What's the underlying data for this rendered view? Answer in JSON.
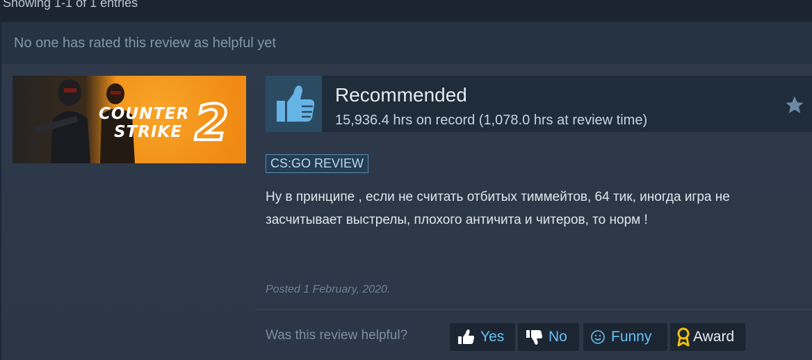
{
  "listing": {
    "entries_text": "Showing 1-1 of 1 entries"
  },
  "review": {
    "helpful_count_text": "No one has rated this review as helpful yet",
    "game": {
      "logo_line1": "COUNTER",
      "logo_line2": "STRIKE",
      "logo_number": "2"
    },
    "verdict": "Recommended",
    "hours": "15,936.4 hrs on record (1,078.0 hrs at review time)",
    "tag": "CS:GO REVIEW",
    "text": "Ну в принципе , если не считать отбитых тиммейтов, 64 тик, иногда игра не засчитывает выстрелы, плохого античита и читеров, то норм !",
    "posted": "Posted 1 February, 2020.",
    "helpful_question": "Was this review helpful?",
    "buttons": {
      "yes": "Yes",
      "no": "No",
      "funny": "Funny",
      "award": "Award"
    }
  },
  "icons": {
    "thumb": "thumbs-up-icon",
    "star": "star-icon",
    "yes": "thumbs-up-icon",
    "no": "thumbs-down-icon",
    "funny": "smiley-icon",
    "award": "award-icon"
  },
  "colors": {
    "background": "#1b2838",
    "link_blue": "#67c1f5",
    "thumb_blue": "#5ca8d8",
    "award_gold": "#f5c30a",
    "capsule_orange": "#f08a12"
  }
}
